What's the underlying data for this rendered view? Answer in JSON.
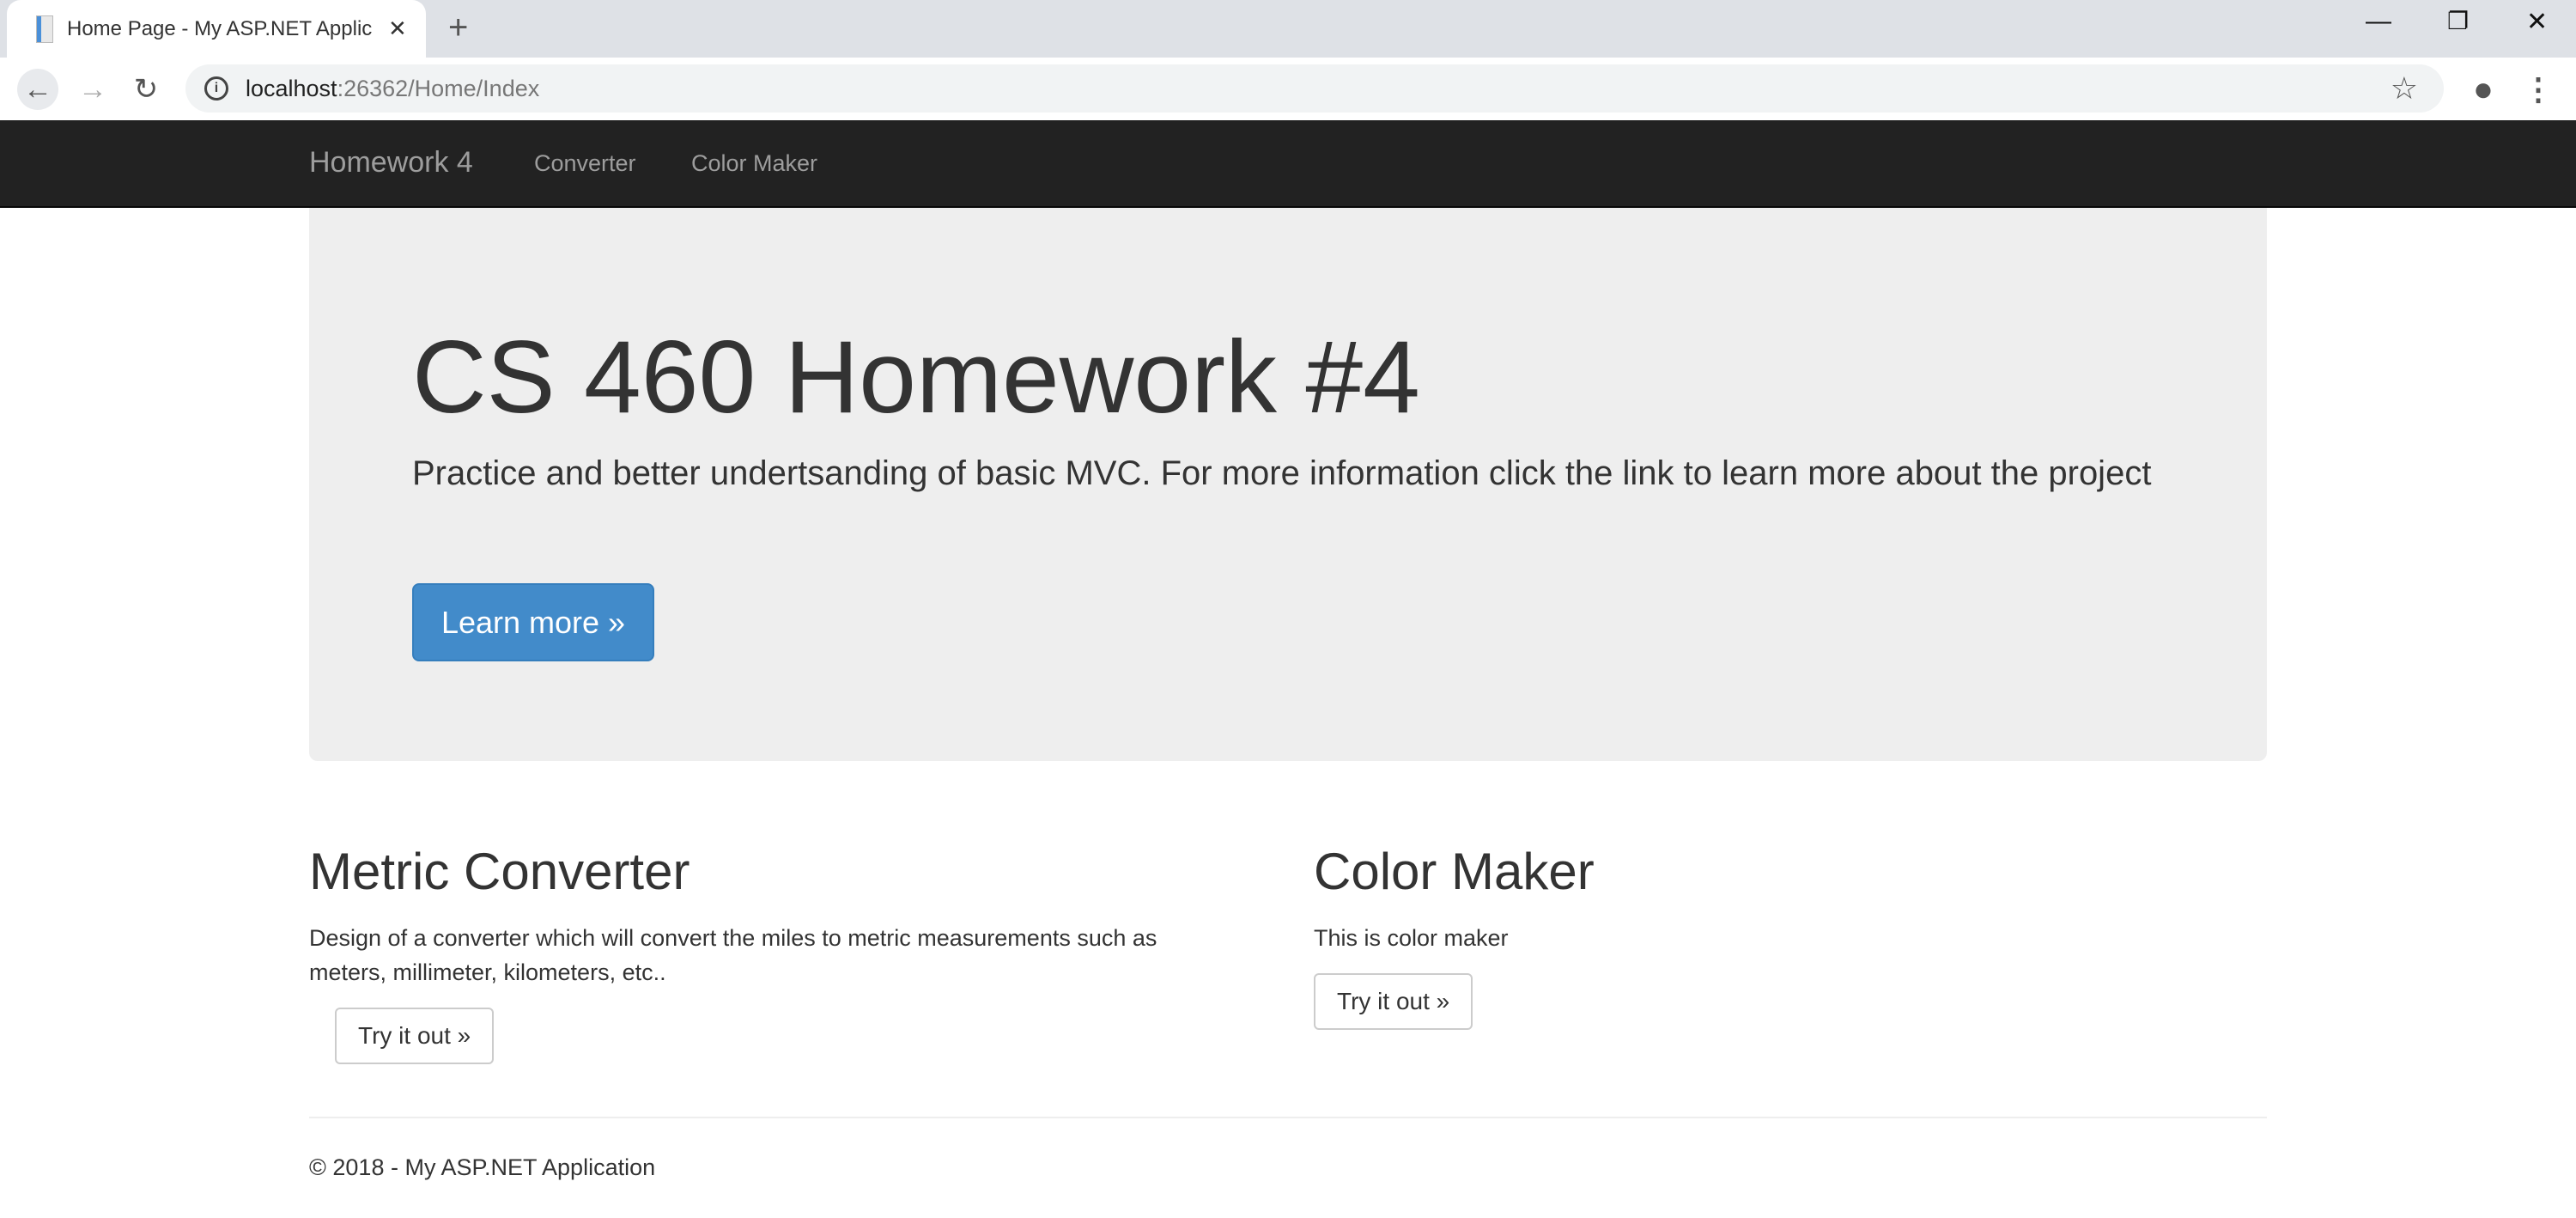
{
  "browser": {
    "tab_title": "Home Page - My ASP.NET Applic",
    "url_host": "localhost",
    "url_rest": ":26362/Home/Index"
  },
  "nav": {
    "brand": "Homework 4",
    "links": [
      "Converter",
      "Color Maker"
    ]
  },
  "jumbotron": {
    "title": "CS 460 Homework #4",
    "lead": "Practice and better undertsanding of basic MVC. For more information click the link to learn more about the project",
    "button": "Learn more »",
    "button_color": "#428bca"
  },
  "columns": [
    {
      "heading": "Metric Converter",
      "text": "Design of a converter which will convert the miles to metric measurements such as meters, millimeter, kilometers, etc..",
      "button": "Try it out »"
    },
    {
      "heading": "Color Maker",
      "text": "This is color maker",
      "button": "Try it out »"
    }
  ],
  "footer": {
    "text": "© 2018 - My ASP.NET Application"
  }
}
